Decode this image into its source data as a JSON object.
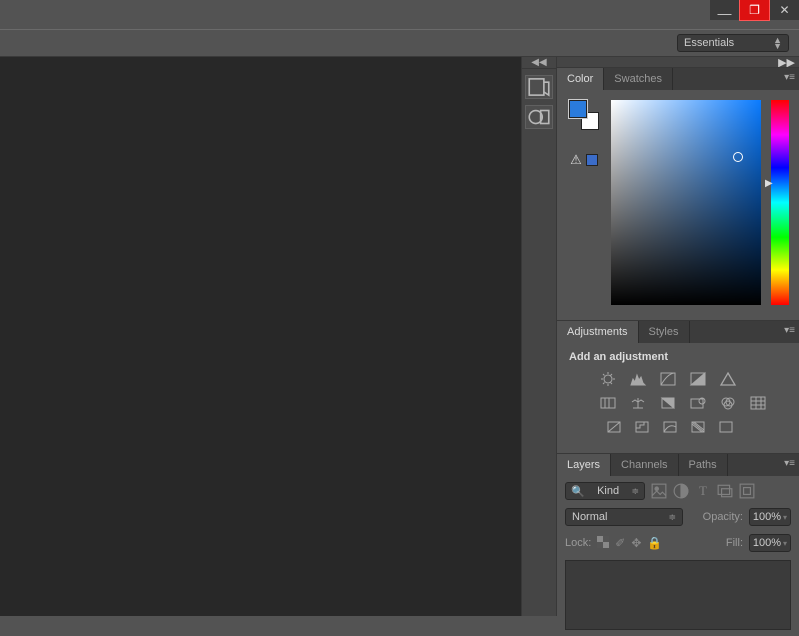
{
  "window": {
    "minimize": "—",
    "maximize": "❐",
    "close": "✕"
  },
  "menubar": {
    "workspace": "Essentials"
  },
  "panels": {
    "color": {
      "tab_color": "Color",
      "tab_swatches": "Swatches",
      "foreground_color": "#2a7bdc",
      "background_color": "#ffffff",
      "warning_swatch": "#3b6cc8"
    },
    "adjustments": {
      "tab_adjustments": "Adjustments",
      "tab_styles": "Styles",
      "heading": "Add an adjustment"
    },
    "layers": {
      "tab_layers": "Layers",
      "tab_channels": "Channels",
      "tab_paths": "Paths",
      "kind_label": "Kind",
      "blend_mode": "Normal",
      "opacity_label": "Opacity:",
      "opacity_value": "100%",
      "lock_label": "Lock:",
      "fill_label": "Fill:",
      "fill_value": "100%"
    }
  }
}
